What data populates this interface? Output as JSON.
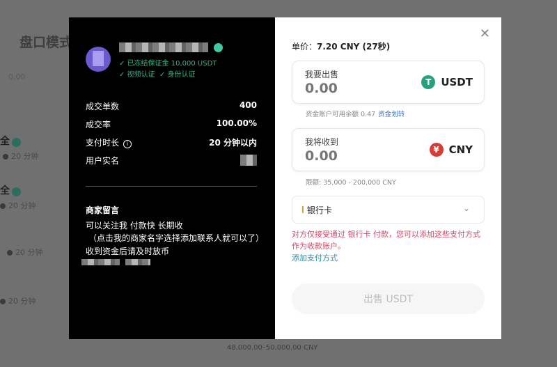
{
  "background": {
    "title": "盘口模式",
    "input_value": "0.00",
    "rows": [
      {
        "name": "全",
        "time": "20 分钟"
      },
      {
        "name": "全",
        "time": "20 分钟"
      },
      {
        "name": "",
        "time": "20 分钟"
      },
      {
        "name": "",
        "time": "20 分钟"
      }
    ],
    "footer_range": "48,000.00–50,000.00 CNY"
  },
  "merchant": {
    "certs": {
      "deposit": "✓ 已冻结保证金 10,000 USDT",
      "video": "✓ 视频认证",
      "id": "✓ 身份认证"
    },
    "stats": [
      {
        "label": "成交单数",
        "value": "400"
      },
      {
        "label": "成交率",
        "value": "100.00%"
      },
      {
        "label": "支付时长",
        "value": "20 分钟以内"
      },
      {
        "label": "用户实名",
        "value": ""
      }
    ],
    "note_title": "商家留言",
    "note_lines": [
      "可以关注我  付款快  长期收",
      "（点击我的商家名字选择添加联系人就可以了）",
      "收到资金后请及时放币"
    ]
  },
  "order": {
    "price_label": "单价：",
    "price_value": "7.20 CNY (27秒)",
    "sell": {
      "label": "我要出售",
      "placeholder": "0.00",
      "currency": "USDT",
      "icon": "T"
    },
    "balance_hint": "资金账户可用余额 0.47",
    "transfer_link": "资金划转",
    "receive": {
      "label": "我将收到",
      "placeholder": "0.00",
      "currency": "CNY",
      "icon": "¥"
    },
    "limit": "限额: 35,000 - 200,000 CNY",
    "payment_method": "银行卡",
    "warning": "对方仅接受通过 银行卡 付款，您可以添加这些支付方式作为收款账户。",
    "add_payment": "添加支付方式",
    "submit": "出售 USDT",
    "close": "✕"
  },
  "colors": {
    "usdt": "#26a17b",
    "cny": "#d63b34",
    "warning": "#d24a6a",
    "link": "#3a74c4"
  }
}
